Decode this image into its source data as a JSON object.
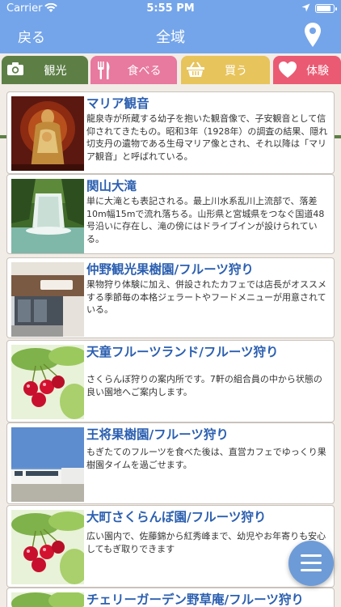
{
  "status": {
    "carrier": "Carrier",
    "time": "5:55 PM",
    "battery_level": 0.9
  },
  "nav": {
    "back_label": "戻る",
    "title": "全域",
    "map_icon": "location-pin-icon"
  },
  "tabs": [
    {
      "label": "観光",
      "icon": "camera-icon",
      "color": "#5d7f46"
    },
    {
      "label": "食べる",
      "icon": "fork-knife-icon",
      "color": "#e8799f"
    },
    {
      "label": "買う",
      "icon": "basket-icon",
      "color": "#e7c45c"
    },
    {
      "label": "体験",
      "icon": "heart-icon",
      "color": "#ea5a73"
    }
  ],
  "items": [
    {
      "name": "マリア観音",
      "desc": "龍泉寺が所蔵する幼子を抱いた観音像で、子安観音として信仰されてきたもの。昭和3年（1928年）の調査の結果、隠れ切支丹の遺物である生母マリア像とされ、それ以降は「マリア観音」と呼ばれている。"
    },
    {
      "name": "関山大滝",
      "desc": "単に大滝とも表記される。最上川水系乱川上流部で、落差10m幅15mで流れ落ちる。山形県と宮城県をつなぐ国道48号沿いに存在し、滝の傍にはドライブインが設けられている。"
    },
    {
      "name": "仲野観光果樹園/フルーツ狩り",
      "desc": "果物狩り体験に加え、併設されたカフェでは店長がオススメする季節毎の本格ジェラートやフードメニューが用意されている。"
    },
    {
      "name": "天童フルーツランド/フルーツ狩り",
      "desc": "さくらんぼ狩りの案内所です。7軒の組合員の中から状態の良い園地へご案内します。"
    },
    {
      "name": "王将果樹園/フルーツ狩り",
      "desc": "もぎたてのフルーツを食べた後は、直営カフェでゆっくり果樹園タイムを過ごせます。"
    },
    {
      "name": "大町さくらんぼ園/フルーツ狩り",
      "desc": "広い園内で、佐藤錦から紅秀峰まで、幼児やお年寄りも安心してもぎ取りできます"
    },
    {
      "name": "チェリーガーデン野草庵/フルーツ狩り",
      "desc": ""
    }
  ],
  "fab": {
    "icon": "menu-icon"
  }
}
